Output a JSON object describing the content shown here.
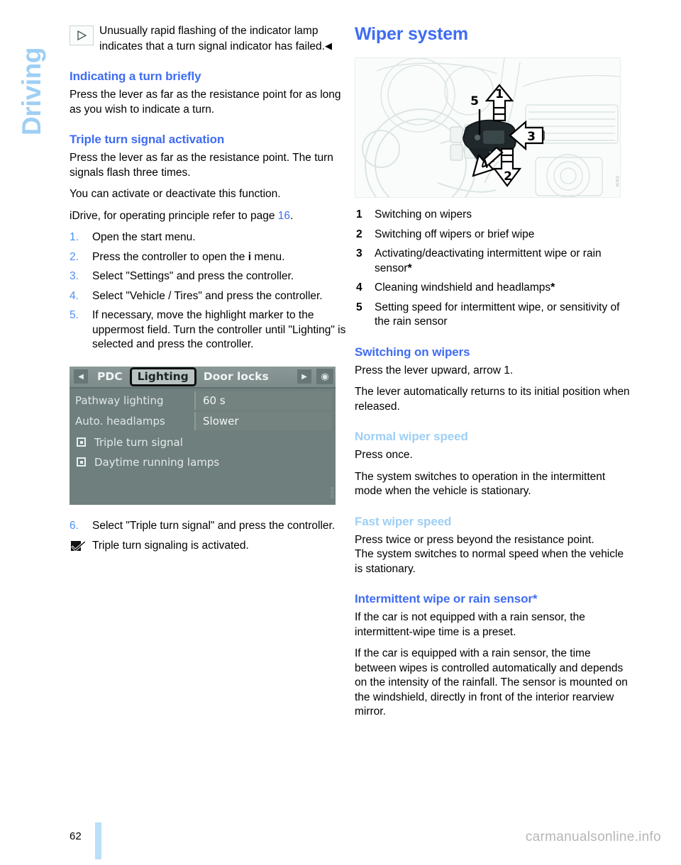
{
  "section_tab": {
    "label": "Driving"
  },
  "left_column": {
    "note": {
      "icon": "turn-signal-indicator-icon",
      "text": "Unusually rapid flashing of the indicator lamp indicates that a turn signal indicator has failed.",
      "end_mark": "◀"
    },
    "heading_indicating": "Indicating a turn briefly",
    "para_indicating": "Press the lever as far as the resistance point for as long as you wish to indicate a turn.",
    "heading_triple": "Triple turn signal activation",
    "para_triple_1": "Press the lever as far as the resistance point. The turn signals flash three times.",
    "para_triple_2": "You can activate or deactivate this function.",
    "para_idrive_prefix": "iDrive, for operating principle refer to page ",
    "para_idrive_page": "16",
    "para_idrive_suffix": ".",
    "steps": [
      {
        "num": "1.",
        "text": "Open the start menu."
      },
      {
        "num": "2.",
        "text_before": "Press the controller to open the ",
        "icon": "info-i-icon",
        "text_after": " menu."
      },
      {
        "num": "3.",
        "text": "Select \"Settings\" and press the controller."
      },
      {
        "num": "4.",
        "text": "Select \"Vehicle / Tires\" and press the controller."
      },
      {
        "num": "5.",
        "text": "If necessary, move the highlight marker to the uppermost field. Turn the controller until \"Lighting\" is selected and press the controller."
      }
    ],
    "idrive_screen": {
      "tabs": {
        "left_arrow": "◀",
        "previous": "PDC",
        "selected": "Lighting",
        "next": "Door locks",
        "right_arrow": "▶",
        "brightness_icon": "brightness-adjust-icon"
      },
      "rows": [
        {
          "label": "Pathway lighting",
          "value": "60 s"
        },
        {
          "label": "Auto. headlamps",
          "value": "Slower"
        }
      ],
      "checkboxes": [
        {
          "label": "Triple turn signal",
          "checked": false
        },
        {
          "label": "Daytime running lamps",
          "checked": false
        }
      ]
    },
    "step_6": {
      "num": "6.",
      "text": "Select \"Triple turn signal\" and press the controller."
    },
    "result": {
      "icon": "checked-box-icon",
      "text": "Triple turn signaling is activated."
    }
  },
  "right_column": {
    "title": "Wiper system",
    "illustration": {
      "name": "wiper-stalk-illustration",
      "callouts": [
        "1",
        "2",
        "3",
        "4",
        "5"
      ]
    },
    "legend": [
      {
        "num": "1",
        "text": "Switching on wipers",
        "star": ""
      },
      {
        "num": "2",
        "text": "Switching off wipers or brief wipe",
        "star": ""
      },
      {
        "num": "3",
        "text": "Activating/deactivating intermittent wipe or rain sensor",
        "star": "*"
      },
      {
        "num": "4",
        "text": "Cleaning windshield and headlamps",
        "star": "*"
      },
      {
        "num": "5",
        "text": "Setting speed for intermittent wipe, or sensitivity of the rain sensor",
        "star": ""
      }
    ],
    "heading_switching": "Switching on wipers",
    "para_switching_1": "Press the lever upward, arrow 1.",
    "para_switching_2": "The lever automatically returns to its initial position when released.",
    "heading_normal": "Normal wiper speed",
    "para_normal_1": "Press once.",
    "para_normal_2": "The system switches to operation in the intermittent mode when the vehicle is stationary.",
    "heading_fast": "Fast wiper speed",
    "para_fast_1": "Press twice or press beyond the resistance point.",
    "para_fast_2": "The system switches to normal speed when the vehicle is stationary.",
    "heading_intermittent": "Intermittent wipe or rain sensor*",
    "para_intermittent_1": "If the car is not equipped with a rain sensor, the intermittent-wipe time is a preset.",
    "para_intermittent_2": "If the car is equipped with a rain sensor, the time between wipes is controlled automatically and depends on the intensity of the rainfall. The sensor is mounted on the windshield, directly in front of the interior rearview mirror."
  },
  "footer": {
    "page_number": "62",
    "watermark": "carmanualsonline.info"
  },
  "colors": {
    "heading_blue": "#3f6cf2",
    "subheading_blue": "#9ecff5",
    "page_ref_blue": "#4c8ff0",
    "folio_bar": "#b9e0f7"
  }
}
